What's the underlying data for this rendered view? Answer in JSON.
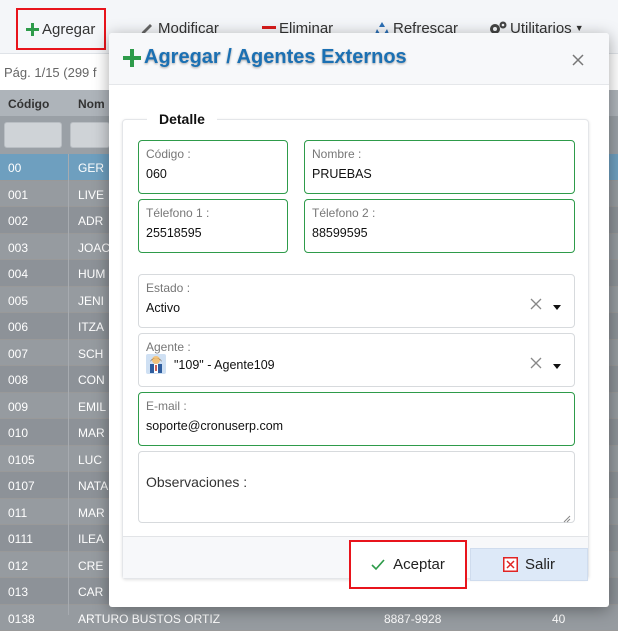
{
  "toolbar": {
    "add_label": "Agregar",
    "modify_label": "Modificar",
    "delete_label": "Eliminar",
    "refresh_label": "Refrescar",
    "utilities_label": "Utilitarios"
  },
  "pager": {
    "text": "Pág. 1/15 (299 f"
  },
  "grid": {
    "headers": [
      "Código",
      "Nom"
    ],
    "rows": [
      {
        "code": "00",
        "name": "GER",
        "phone": "",
        "num": ""
      },
      {
        "code": "001",
        "name": "LIVE",
        "phone": "",
        "num": ""
      },
      {
        "code": "002",
        "name": "ADR",
        "phone": "",
        "num": ""
      },
      {
        "code": "003",
        "name": "JOAC",
        "phone": "",
        "num": ""
      },
      {
        "code": "004",
        "name": "HUM",
        "phone": "",
        "num": ""
      },
      {
        "code": "005",
        "name": "JENI",
        "phone": "",
        "num": ""
      },
      {
        "code": "006",
        "name": "ITZA",
        "phone": "",
        "num": ""
      },
      {
        "code": "007",
        "name": "SCH",
        "phone": "",
        "num": ""
      },
      {
        "code": "008",
        "name": "CON",
        "phone": "",
        "num": ""
      },
      {
        "code": "009",
        "name": "EMIL",
        "phone": "",
        "num": ""
      },
      {
        "code": "010",
        "name": "MAR",
        "phone": "",
        "num": ""
      },
      {
        "code": "0105",
        "name": "LUC",
        "phone": "",
        "num": ""
      },
      {
        "code": "0107",
        "name": "NATA",
        "phone": "",
        "num": ""
      },
      {
        "code": "011",
        "name": "MAR",
        "phone": "",
        "num": ""
      },
      {
        "code": "0111",
        "name": "ILEA",
        "phone": "",
        "num": ""
      },
      {
        "code": "012",
        "name": "CRE",
        "phone": "",
        "num": ""
      },
      {
        "code": "013",
        "name": "CAR",
        "phone": "",
        "num": ""
      },
      {
        "code": "0138",
        "name": "ARTURO BUSTOS ORTIZ",
        "phone": "8887-9928",
        "num": "40"
      }
    ]
  },
  "modal": {
    "title": "Agregar / Agentes Externos",
    "section_title": "Detalle",
    "fields": {
      "codigo": {
        "label": "Código :",
        "value": "060"
      },
      "nombre": {
        "label": "Nombre :",
        "value": "PRUEBAS"
      },
      "telefono1": {
        "label": "Télefono 1 :",
        "value": "25518595"
      },
      "telefono2": {
        "label": "Télefono 2 :",
        "value": "88599595"
      },
      "estado": {
        "label": "Estado :",
        "value": "Activo"
      },
      "agente": {
        "label": "Agente :",
        "value": "\"109\" - Agente109"
      },
      "email": {
        "label": "E-mail :",
        "value": "soporte@cronuserp.com"
      },
      "observaciones": {
        "label": "Observaciones :",
        "value": ""
      }
    },
    "accept_label": "Aceptar",
    "exit_label": "Salir"
  },
  "colors": {
    "accent_blue": "#1b70b3",
    "field_valid_green": "#2e9b4a",
    "highlight_red": "#e8141c",
    "add_green": "#2e9b4a",
    "delete_red": "#d81b1b",
    "exit_red": "#e02424"
  },
  "icons": {
    "add": "plus-icon",
    "modify": "pencil-icon",
    "delete": "minus-icon",
    "refresh": "recycle-icon",
    "utilities": "gears-icon",
    "close": "close-icon",
    "clear": "clear-x-icon",
    "dropdown": "caret-down-icon",
    "agent": "agent-avatar-icon",
    "accept": "checkmark-icon",
    "exit": "x-square-icon"
  }
}
